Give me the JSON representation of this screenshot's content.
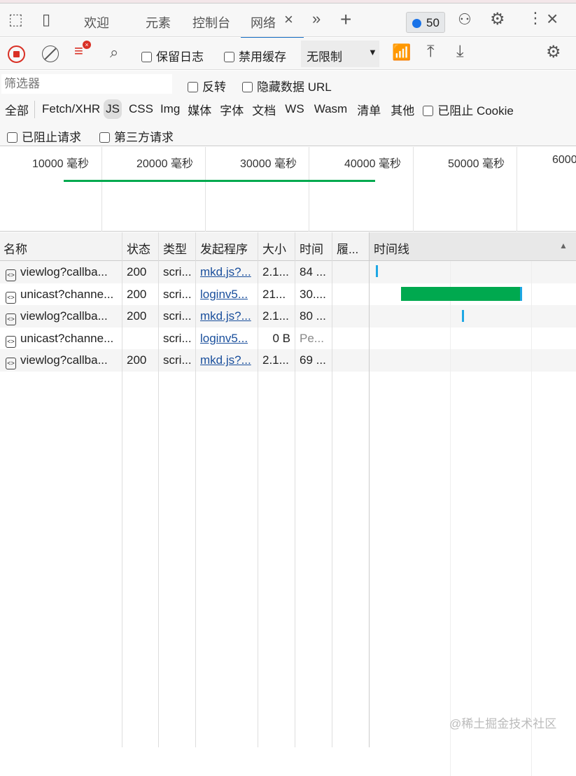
{
  "tabs": {
    "welcome": "欢迎",
    "elements": "元素",
    "console": "控制台",
    "network": "网络",
    "issues_count": "50"
  },
  "toolbar": {
    "preserve_log": "保留日志",
    "disable_cache": "禁用缓存",
    "throttle": "无限制"
  },
  "filter": {
    "placeholder": "筛选器",
    "invert": "反转",
    "hide_data_urls": "隐藏数据 URL",
    "types": [
      "全部",
      "Fetch/XHR",
      "JS",
      "CSS",
      "Img",
      "媒体",
      "字体",
      "文档",
      "WS",
      "Wasm",
      "清单",
      "其他"
    ],
    "selected_type": "JS",
    "blocked_cookies": "已阻止 Cookie",
    "blocked_requests": "已阻止请求",
    "third_party": "第三方请求"
  },
  "overview": {
    "ticks": [
      "10000  毫秒",
      "20000  毫秒",
      "30000  毫秒",
      "40000  毫秒",
      "50000  毫秒",
      "6000"
    ]
  },
  "table": {
    "headers": [
      "名称",
      "状态",
      "类型",
      "发起程序",
      "大小",
      "时间",
      "履...",
      "时间线"
    ],
    "rows": [
      {
        "name": "viewlog?callba...",
        "status": "200",
        "type": "scri...",
        "initiator": "mkd.js?...",
        "size": "2.1...",
        "time": "84 ..."
      },
      {
        "name": "unicast?channe...",
        "status": "200",
        "type": "scri...",
        "initiator": "loginv5...",
        "size": "21...",
        "time": "30...."
      },
      {
        "name": "viewlog?callba...",
        "status": "200",
        "type": "scri...",
        "initiator": "mkd.js?...",
        "size": "2.1...",
        "time": "80 ..."
      },
      {
        "name": "unicast?channe...",
        "status": "",
        "type": "scri...",
        "initiator": "loginv5...",
        "size": "0 B",
        "time": "Pe..."
      },
      {
        "name": "viewlog?callba...",
        "status": "200",
        "type": "scri...",
        "initiator": "mkd.js?...",
        "size": "2.1...",
        "time": "69 ..."
      }
    ]
  },
  "watermark": "@稀土掘金技术社区",
  "colors": {
    "accent": "#1a73c8",
    "record": "#d93025",
    "timeline_green": "#00a94f",
    "timeline_blue": "#1ea7e4"
  }
}
